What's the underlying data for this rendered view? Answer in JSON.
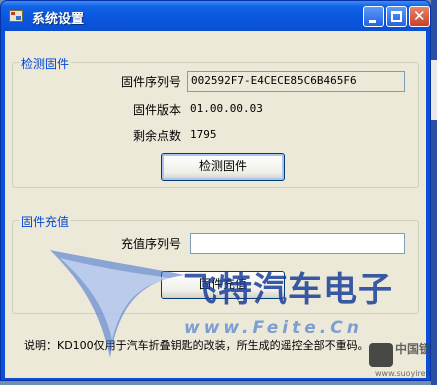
{
  "window": {
    "title": "系统设置"
  },
  "detect_group": {
    "legend": "检测固件",
    "serial_label": "固件序列号",
    "serial_value": "002592F7-E4CECE85C6B465F6",
    "version_label": "固件版本",
    "version_value": "01.00.00.03",
    "points_label": "剩余点数",
    "points_value": "1795",
    "detect_button": "检测固件"
  },
  "recharge_group": {
    "legend": "固件充值",
    "serial_label": "充值序列号",
    "serial_value": "",
    "recharge_button": "固件充值"
  },
  "note": "说明：KD100仅用于汽车折叠钥匙的改装，所生成的遥控全部不重码。",
  "watermark": {
    "brand": "飞特汽车电子",
    "url": "www.Feite.Cn",
    "site_brand": "中国锁具人",
    "site_url": "www.suoyiren.com"
  },
  "colors": {
    "titlebar": "#0a56de",
    "client_bg": "#ece9d8",
    "legend": "#0046d5",
    "close_button": "#c8412a"
  }
}
